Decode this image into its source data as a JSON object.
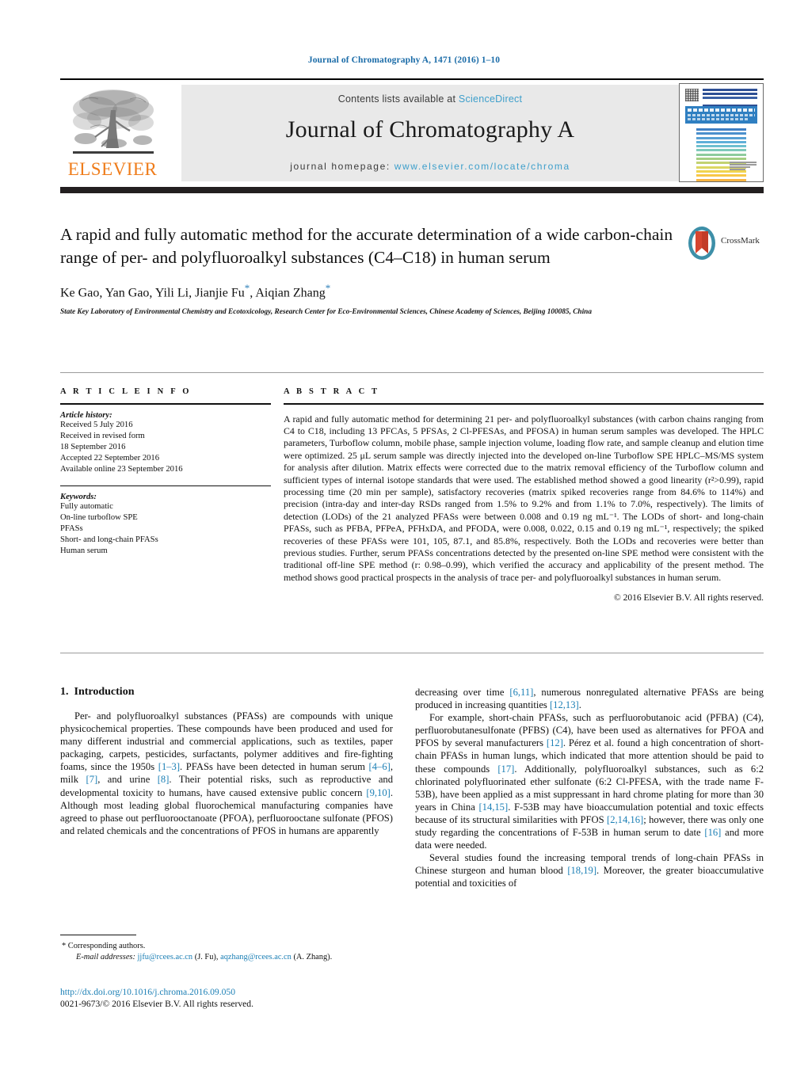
{
  "running_head": "Journal of Chromatography A, 1471 (2016) 1–10",
  "masthead": {
    "contents_prefix": "Contents lists available at ",
    "sciencedirect": "ScienceDirect",
    "journal_title": "Journal of Chromatography A",
    "homepage_prefix": "journal homepage: ",
    "homepage_url": "www.elsevier.com/locate/chroma",
    "publisher_wordmark": "ELSEVIER",
    "publisher_color": "#ef7c1a",
    "link_color": "#3e9fcb"
  },
  "cover": {
    "band_title": "JOURNAL OF CHROMATOGRAPHY A",
    "band_color": "#2f7fc1",
    "spectrum_colors": [
      "#3f7fc4",
      "#4b90cd",
      "#57a0d4",
      "#5fb0d8",
      "#6ebfcf",
      "#7fc9ba",
      "#8ecb9d",
      "#a6ce83",
      "#c2d272",
      "#dcd663",
      "#f0d44f",
      "#f8c748",
      "#f7b441",
      "#f39f3a",
      "#ee8a36",
      "#e97532",
      "#e4602f",
      "#df4c2c"
    ]
  },
  "article": {
    "title": "A rapid and fully automatic method for the accurate determination of a wide carbon-chain range of per- and polyfluoroalkyl substances (C4–C18) in human serum",
    "authors_plain": "Ke Gao, Yan Gao, Yili Li, Jianjie Fu",
    "authors_tail": ", Aiqian Zhang",
    "affiliation": "State Key Laboratory of Environmental Chemistry and Ecotoxicology, Research Center for Eco-Environmental Sciences, Chinese Academy of Sciences, Beijing 100085, China",
    "crossmark_label": "CrossMark"
  },
  "info": {
    "heading": "A R T I C L E   I N F O",
    "history_label": "Article history:",
    "history_lines": [
      "Received 5 July 2016",
      "Received in revised form",
      "18 September 2016",
      "Accepted 22 September 2016",
      "Available online 23 September 2016"
    ],
    "keywords_label": "Keywords:",
    "keywords": [
      "Fully automatic",
      "On-line turboflow SPE",
      "PFASs",
      "Short- and long-chain PFASs",
      "Human serum"
    ]
  },
  "abstract": {
    "heading": "A B S T R A C T",
    "text": "A rapid and fully automatic method for determining 21 per- and polyfluoroalkyl substances (with carbon chains ranging from C4 to C18, including 13 PFCAs, 5 PFSAs, 2 Cl-PFESAs, and PFOSA) in human serum samples was developed. The HPLC parameters, Turboflow column, mobile phase, sample injection volume, loading flow rate, and sample cleanup and elution time were optimized. 25 μL serum sample was directly injected into the developed on-line Turboflow SPE HPLC–MS/MS system for analysis after dilution. Matrix effects were corrected due to the matrix removal efficiency of the Turboflow column and sufficient types of internal isotope standards that were used. The established method showed a good linearity (r²>0.99), rapid processing time (20 min per sample), satisfactory recoveries (matrix spiked recoveries range from 84.6% to 114%) and precision (intra-day and inter-day RSDs ranged from 1.5% to 9.2% and from 1.1% to 7.0%, respectively). The limits of detection (LODs) of the 21 analyzed PFASs were between 0.008 and 0.19 ng mL⁻¹. The LODs of short- and long-chain PFASs, such as PFBA, PFPeA, PFHxDA, and PFODA, were 0.008, 0.022, 0.15 and 0.19 ng mL⁻¹, respectively; the spiked recoveries of these PFASs were 101, 105, 87.1, and 85.8%, respectively. Both the LODs and recoveries were better than previous studies. Further, serum PFASs concentrations detected by the presented on-line SPE method were consistent with the traditional off-line SPE method (r: 0.98–0.99), which verified the accuracy and applicability of the present method. The method shows good practical prospects in the analysis of trace per- and polyfluoroalkyl substances in human serum.",
    "copyright": "© 2016 Elsevier B.V. All rights reserved."
  },
  "introduction": {
    "number": "1.",
    "title": "Introduction",
    "left_paragraphs": [
      "Per- and polyfluoroalkyl substances (PFASs) are compounds with unique physicochemical properties. These compounds have been produced and used for many different industrial and commercial applications, such as textiles, paper packaging, carpets, pesticides, surfactants, polymer additives and fire-fighting foams, since the 1950s [1–3]. PFASs have been detected in human serum [4–6], milk [7], and urine [8]. Their potential risks, such as reproductive and developmental toxicity to humans, have caused extensive public concern [9,10]. Although most leading global fluorochemical manufacturing companies have agreed to phase out perfluorooctanoate (PFOA), perfluorooctane sulfonate (PFOS) and related chemicals and the concentrations of PFOS in humans are apparently"
    ],
    "right_paragraphs": [
      "decreasing over time [6,11], numerous nonregulated alternative PFASs are being produced in increasing quantities [12,13].",
      "For example, short-chain PFASs, such as perfluorobutanoic acid (PFBA) (C4), perfluorobutanesulfonate (PFBS) (C4), have been used as alternatives for PFOA and PFOS by several manufacturers [12]. Pérez et al. found a high concentration of short-chain PFASs in human lungs, which indicated that more attention should be paid to these compounds [17]. Additionally, polyfluoroalkyl substances, such as 6:2 chlorinated polyfluorinated ether sulfonate (6:2 Cl-PFESA, with the trade name F-53B), have been applied as a mist suppressant in hard chrome plating for more than 30 years in China [14,15]. F-53B may have bioaccumulation potential and toxic effects because of its structural similarities with PFOS [2,14,16]; however, there was only one study regarding the concentrations of F-53B in human serum to date [16] and more data were needed.",
      "Several studies found the increasing temporal trends of long-chain PFASs in Chinese sturgeon and human blood [18,19]. Moreover, the greater bioaccumulative potential and toxicities of"
    ]
  },
  "footnote": {
    "corresponding": "* Corresponding authors.",
    "email_label": "E-mail addresses:",
    "email1": "jjfu@rcees.ac.cn",
    "email1_who": "(J. Fu),",
    "email2": "aqzhang@rcees.ac.cn",
    "email2_who": "(A. Zhang)."
  },
  "imprint": {
    "doi": "http://dx.doi.org/10.1016/j.chroma.2016.09.050",
    "issn_line": "0021-9673/© 2016 Elsevier B.V. All rights reserved."
  }
}
